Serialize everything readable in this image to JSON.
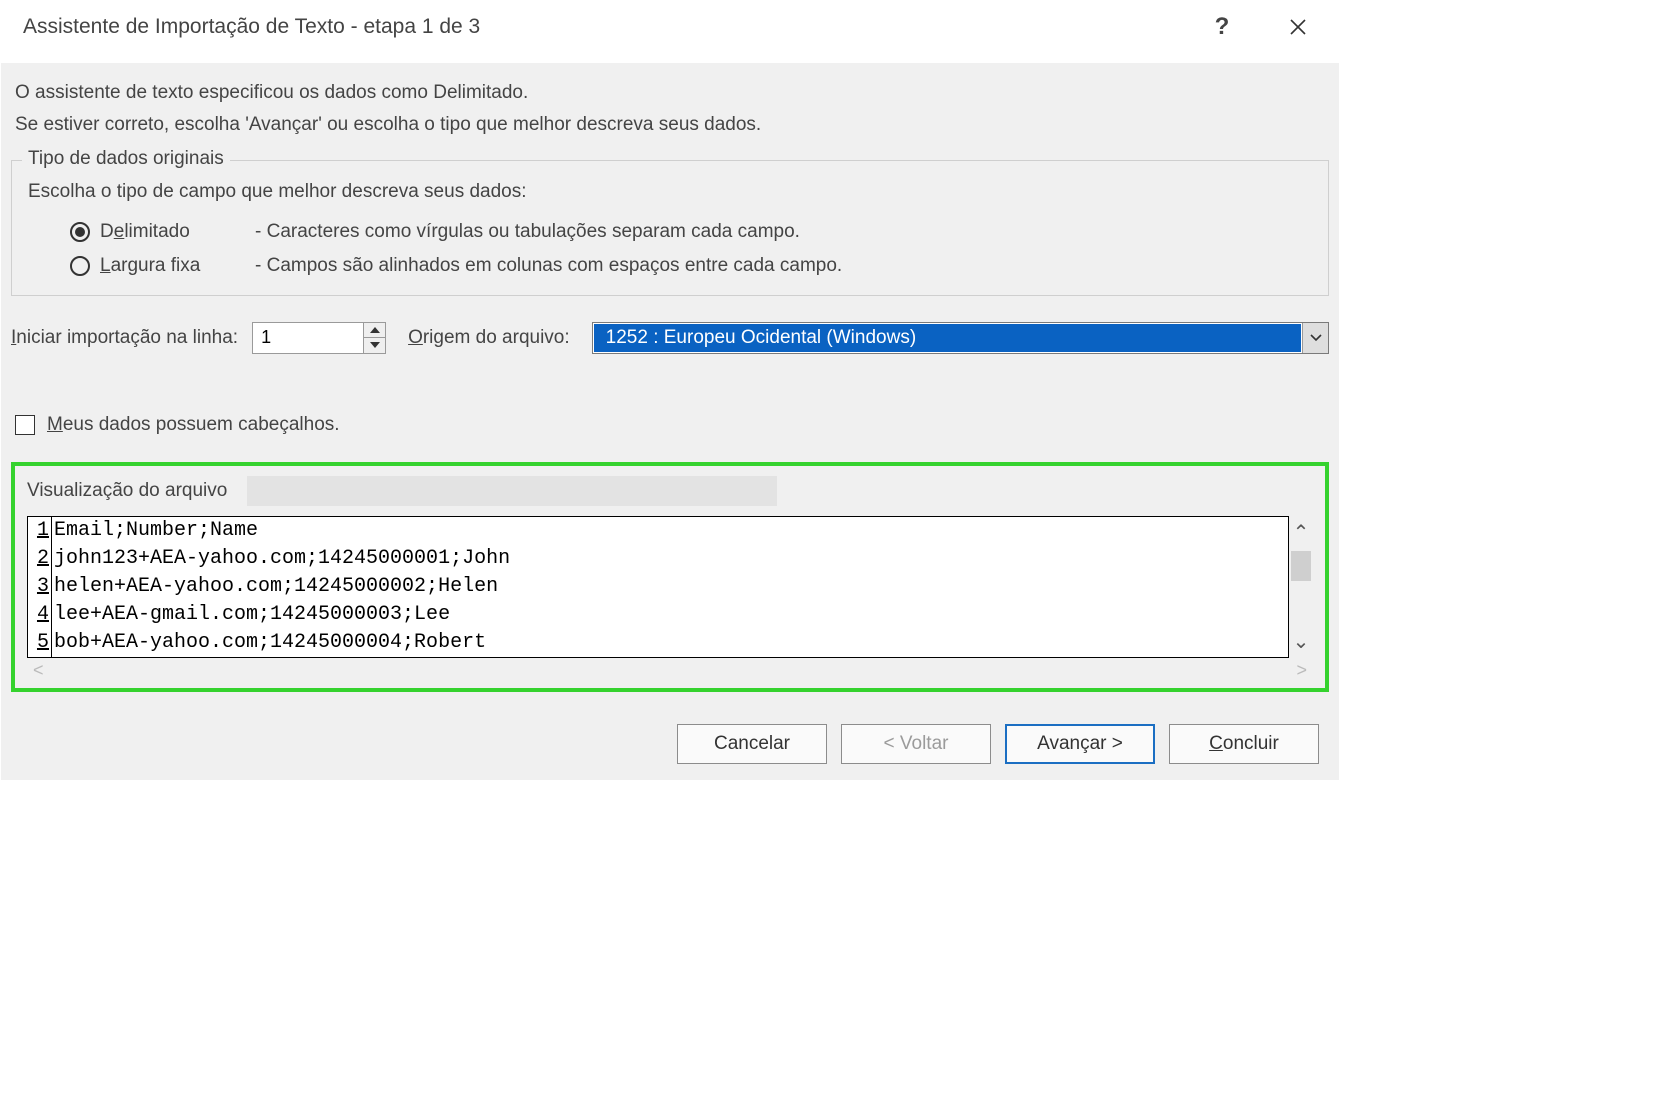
{
  "title": "Assistente de Importação de Texto - etapa 1 de 3",
  "intro_line1": "O assistente de texto especificou os dados como Delimitado.",
  "intro_line2": "Se estiver correto, escolha 'Avançar' ou escolha o tipo que melhor descreva seus dados.",
  "group": {
    "title": "Tipo de dados originais",
    "instruction": "Escolha o tipo de campo que melhor descreva seus dados:",
    "options": [
      {
        "label_pre": "D",
        "label_mn": "e",
        "label_post": "limitado",
        "desc": "- Caracteres como vírgulas ou tabulações separam cada campo.",
        "checked": true
      },
      {
        "label_pre": "",
        "label_mn": "L",
        "label_post": "argura fixa",
        "desc": "- Campos são alinhados em colunas com espaços entre cada campo.",
        "checked": false
      }
    ]
  },
  "start_row": {
    "label_pre": "",
    "label_mn": "I",
    "label_post": "niciar importação na linha:",
    "value": "1"
  },
  "origin": {
    "label_pre": "",
    "label_mn": "O",
    "label_post": "rigem do arquivo:",
    "value": "1252 : Europeu Ocidental (Windows)"
  },
  "headers_chk": {
    "label_pre": "",
    "label_mn": "M",
    "label_post": "eus dados possuem cabeçalhos.",
    "checked": false
  },
  "preview": {
    "title": "Visualização do arquivo",
    "lines": [
      "Email;Number;Name",
      "john123+AEA-yahoo.com;14245000001;John",
      "helen+AEA-yahoo.com;14245000002;Helen",
      "lee+AEA-gmail.com;14245000003;Lee",
      "bob+AEA-yahoo.com;14245000004;Robert"
    ]
  },
  "buttons": {
    "cancel": "Cancelar",
    "back": "< Voltar",
    "next": "Avançar >",
    "finish_pre": "",
    "finish_mn": "C",
    "finish_post": "oncluir"
  }
}
